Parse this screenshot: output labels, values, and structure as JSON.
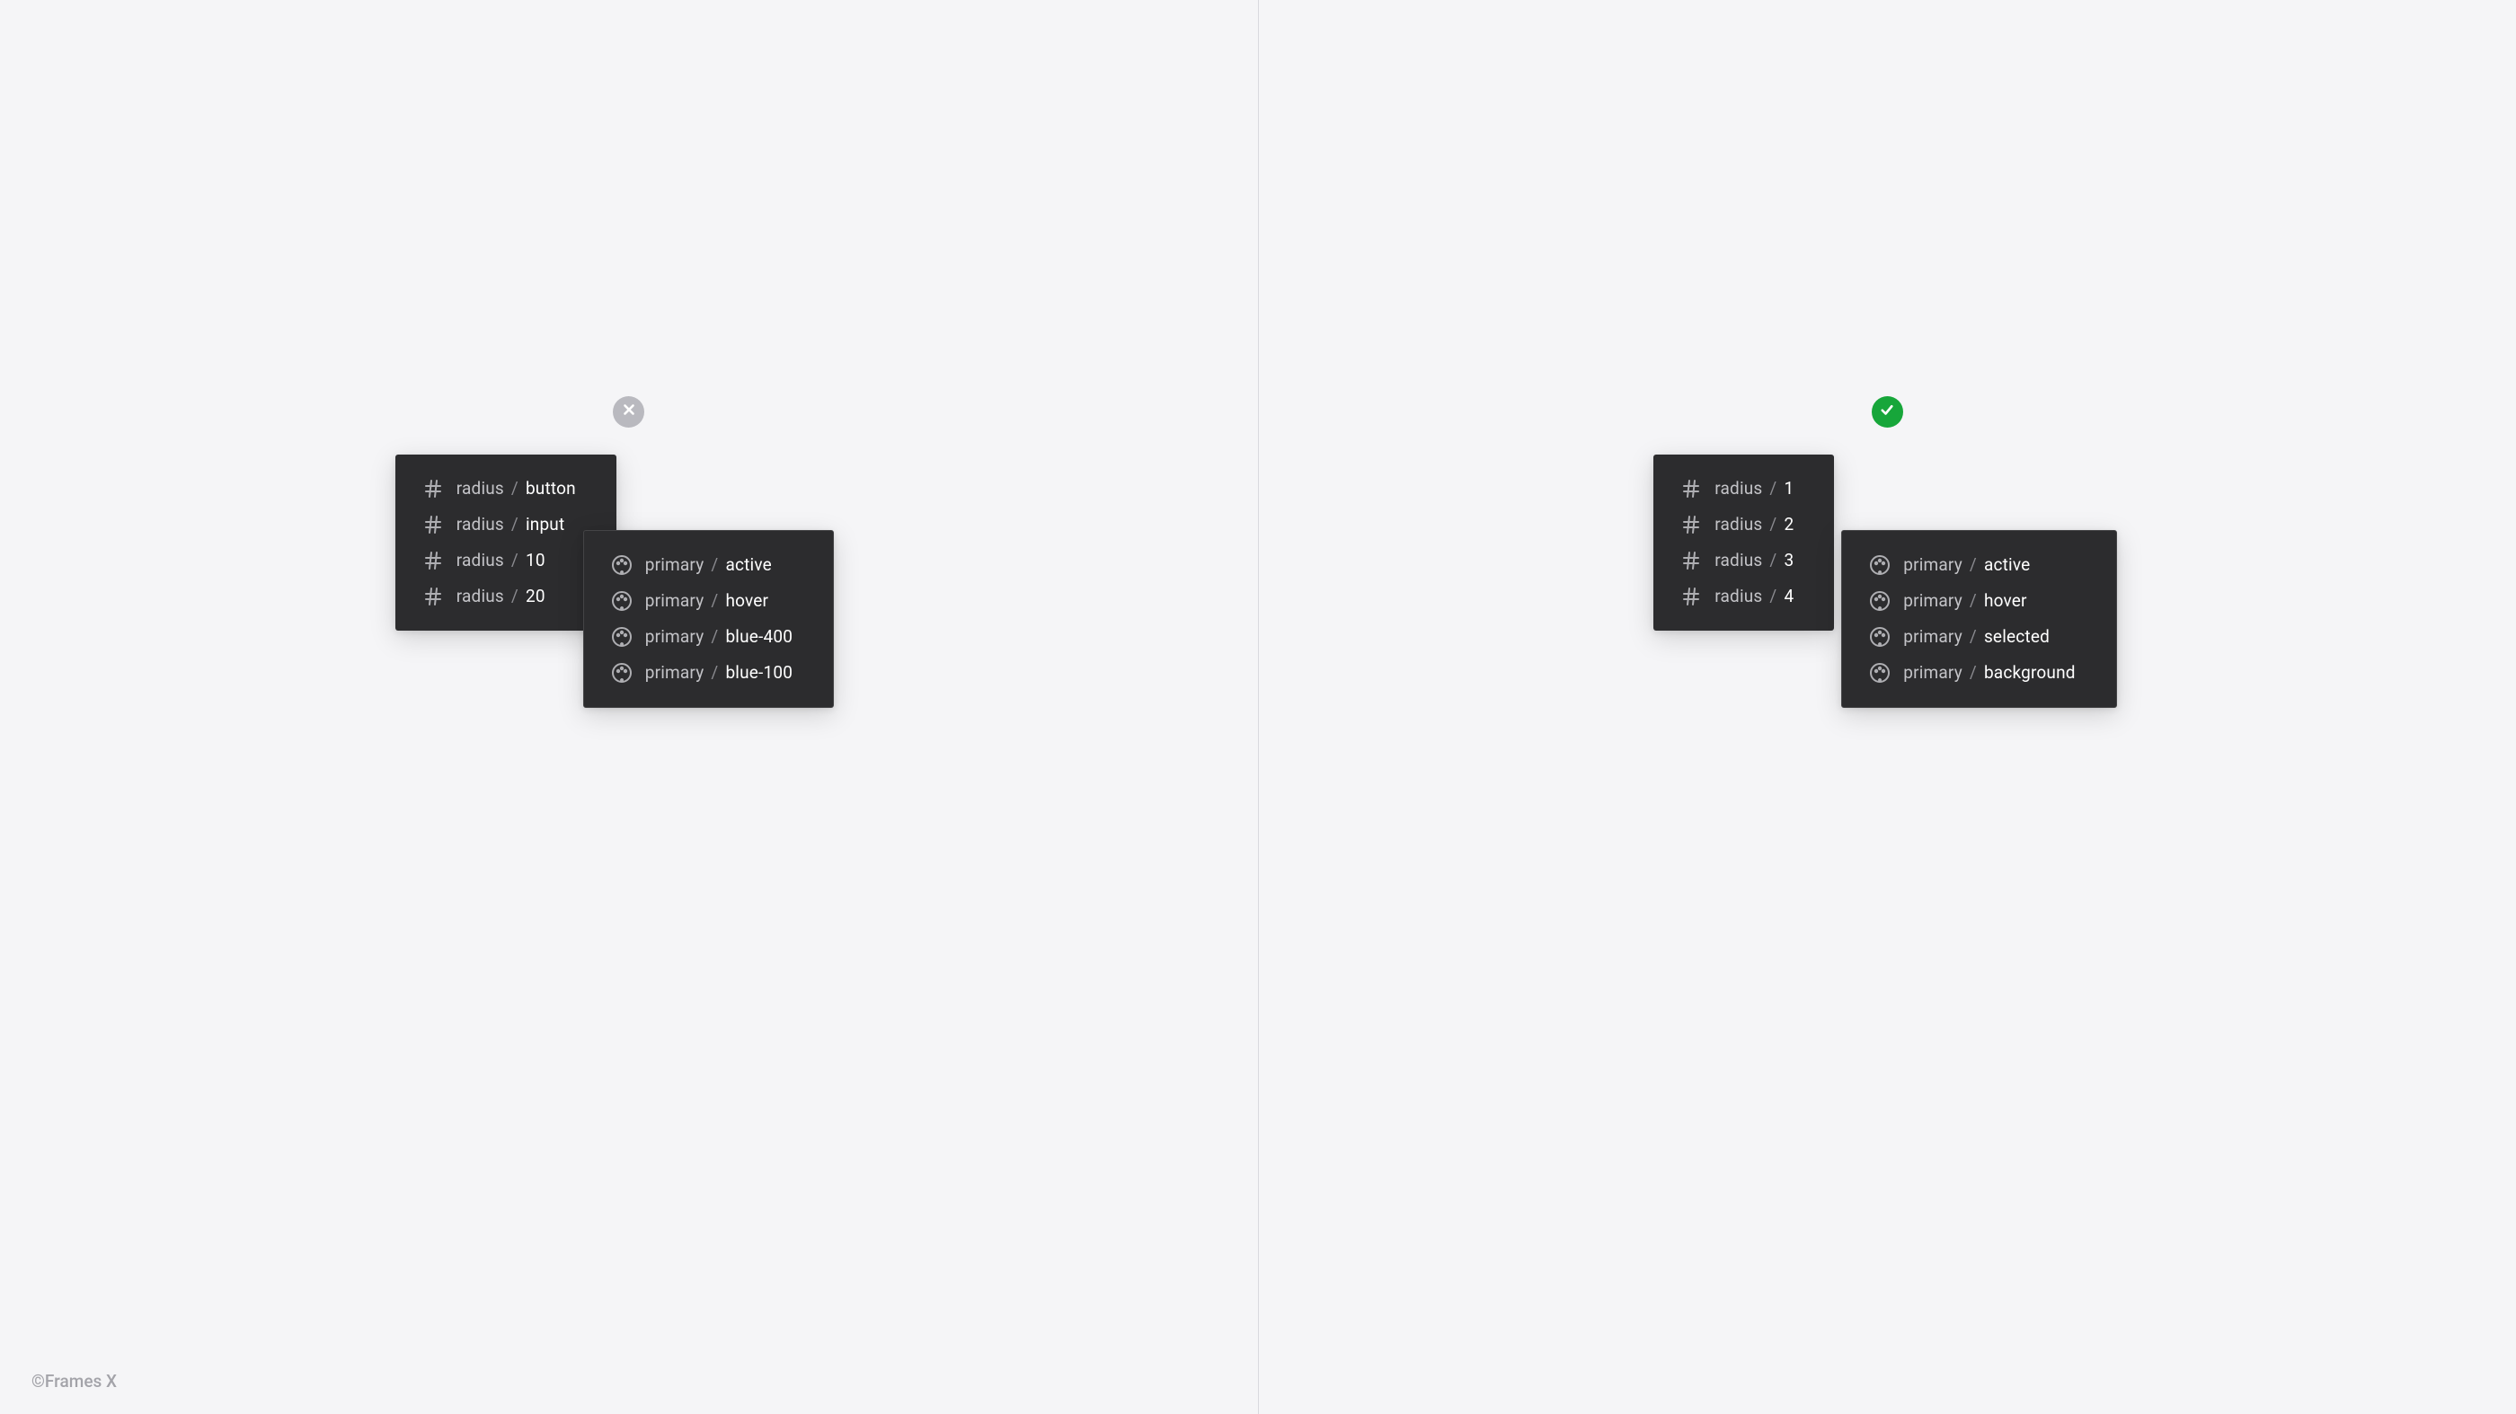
{
  "attribution": "©Frames X",
  "left": {
    "status": "incorrect",
    "panel1": {
      "icon": "hash",
      "rows": [
        {
          "prefix": "radius",
          "name": "button"
        },
        {
          "prefix": "radius",
          "name": "input"
        },
        {
          "prefix": "radius",
          "name": "10"
        },
        {
          "prefix": "radius",
          "name": "20"
        }
      ]
    },
    "panel2": {
      "icon": "palette",
      "rows": [
        {
          "prefix": "primary",
          "name": "active"
        },
        {
          "prefix": "primary",
          "name": "hover"
        },
        {
          "prefix": "primary",
          "name": "blue-400"
        },
        {
          "prefix": "primary",
          "name": "blue-100"
        }
      ]
    }
  },
  "right": {
    "status": "correct",
    "panel1": {
      "icon": "hash",
      "rows": [
        {
          "prefix": "radius",
          "name": "1"
        },
        {
          "prefix": "radius",
          "name": "2"
        },
        {
          "prefix": "radius",
          "name": "3"
        },
        {
          "prefix": "radius",
          "name": "4"
        }
      ]
    },
    "panel2": {
      "icon": "palette",
      "rows": [
        {
          "prefix": "primary",
          "name": "active"
        },
        {
          "prefix": "primary",
          "name": "hover"
        },
        {
          "prefix": "primary",
          "name": "selected"
        },
        {
          "prefix": "primary",
          "name": "background"
        }
      ]
    }
  },
  "separator": "/"
}
